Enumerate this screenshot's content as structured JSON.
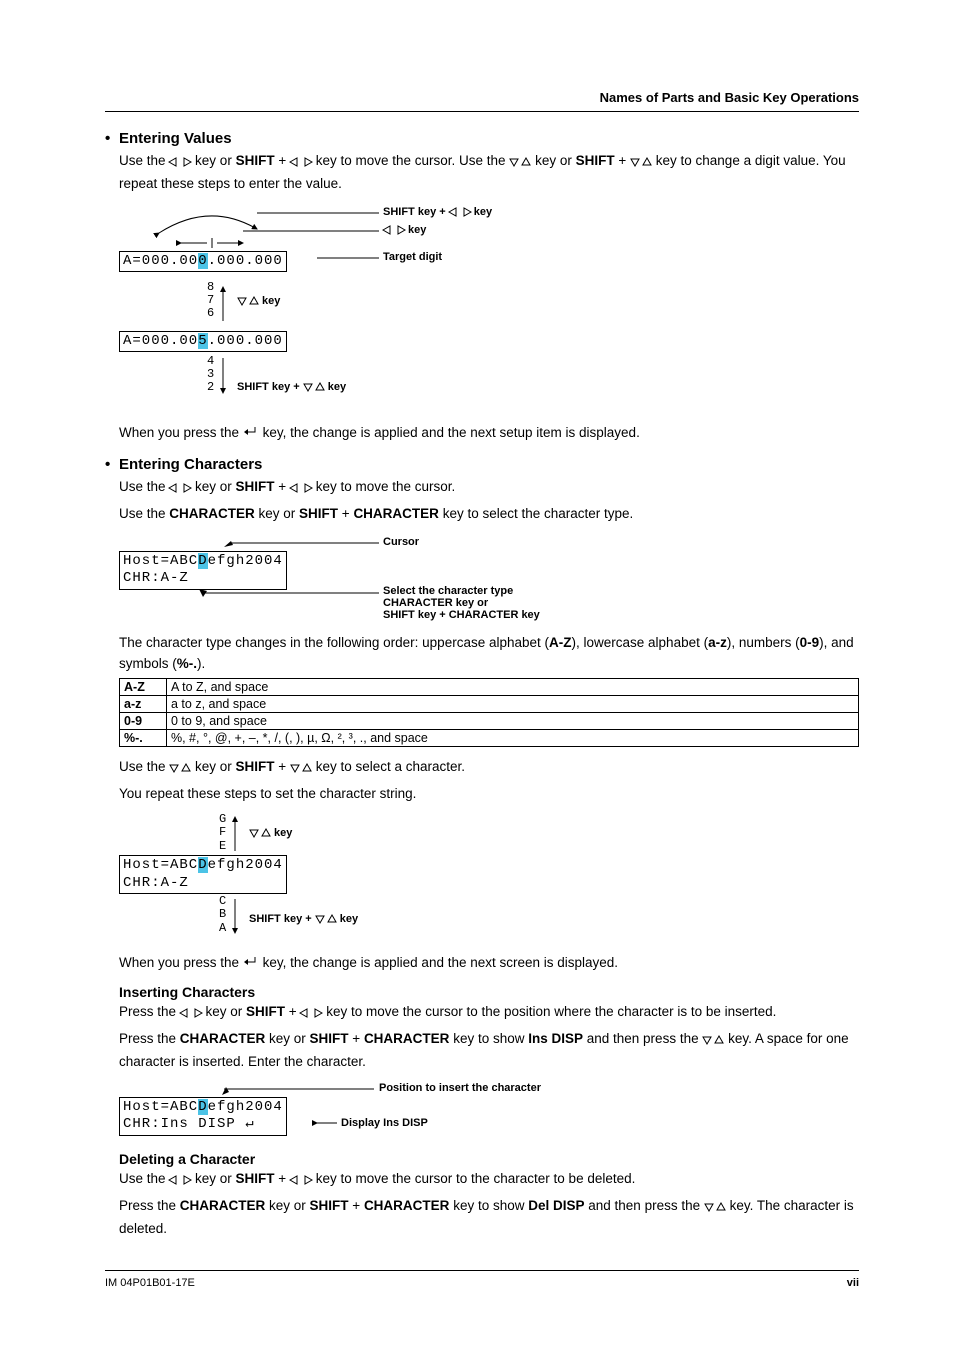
{
  "header": {
    "title": "Names of Parts and Basic Key Operations"
  },
  "sec_values": {
    "heading": "Entering Values",
    "intro_a": "Use the ",
    "intro_b": " key or ",
    "intro_c": " + ",
    "intro_d": " key to move the cursor. Use the ",
    "intro_e": " key or ",
    "intro_f": " + ",
    "intro_g": " key to change a digit value. You repeat these steps to enter the value.",
    "shift": "SHIFT",
    "lbl_shift_lr": "SHIFT key + ",
    "lbl_lr": " key",
    "lbl_key": " key",
    "lbl_target": "Target digit",
    "lbl_ud": " key",
    "lbl_shift_ud": "SHIFT key + ",
    "lcd1_pre": "A=000.00",
    "lcd1_hl": "0",
    "lcd1_post": ".000.000",
    "lcd2_pre": "A=000.00",
    "lcd2_hl": "5",
    "lcd2_post": ".000.000",
    "stack_up": [
      "8",
      "7",
      "6"
    ],
    "stack_dn": [
      "4",
      "3",
      "2"
    ],
    "post_a": "When you press the ",
    "post_b": " key, the change is applied and the next setup item is displayed."
  },
  "sec_chars": {
    "heading": "Entering Characters",
    "l1a": "Use the ",
    "l1b": " key or ",
    "l1c": " + ",
    "l1d": " key to move the cursor.",
    "l2a": "Use the ",
    "l2b": " key or ",
    "l2c": " + ",
    "l2d": " key to select the character type.",
    "char_key": "CHARACTER",
    "shift": "SHIFT",
    "lbl_cursor": "Cursor",
    "lbl_select": "Select the character type",
    "lbl_char_key": "CHARACTER key or",
    "lbl_shift_char": "SHIFT key + CHARACTER key",
    "lcd1a_pre": "Host=ABC",
    "lcd1a_hl": "D",
    "lcd1a_post": "efgh2004",
    "lcd1b": "CHR:A-Z",
    "order_a": "The character type changes in the following order: uppercase alphabet (",
    "order_b": "), lowercase alphabet (",
    "order_c": "), numbers (",
    "order_d": "), and symbols (",
    "order_e": ").",
    "AZ": "A-Z",
    "az": "a-z",
    "n09": "0-9",
    "sym": "%-.",
    "table": [
      {
        "k": "A-Z",
        "v": "A to Z, and space"
      },
      {
        "k": "a-z",
        "v": "a to z, and space"
      },
      {
        "k": "0-9",
        "v": "0 to 9, and space"
      },
      {
        "k": "%-.",
        "v": "%, #, °, @, +, –, *, /, (, ), µ, Ω, ², ³, ., and space"
      }
    ],
    "sel_a": "Use the ",
    "sel_b": " key or ",
    "sel_c": " + ",
    "sel_d": " key to select a character.",
    "repeat": "You repeat these steps to set the character string.",
    "stack_up": [
      "G",
      "F",
      "E"
    ],
    "stack_dn": [
      "C",
      "B",
      "A"
    ],
    "lbl_ud": " key",
    "lbl_shift_ud": "SHIFT key + ",
    "post_a": "When you press the ",
    "post_b": " key, the change is applied and the next screen is displayed."
  },
  "sec_insert": {
    "heading": "Inserting Characters",
    "l1a": "Press the ",
    "l1b": " key or ",
    "l1c": " + ",
    "l1d": " key to move the cursor to the position where the character is to be inserted.",
    "l2a": "Press the ",
    "l2b": " key or ",
    "l2c": " + ",
    "l2d": " key to show ",
    "l2e": " and then press the ",
    "l2f": " key. A space for one character is inserted. Enter the character.",
    "ins_disp": "Ins DISP",
    "char_key": "CHARACTER",
    "shift": "SHIFT",
    "lbl_pos": "Position to insert the character",
    "lbl_disp": "Display Ins DISP",
    "lcd_a_pre": "Host=ABC",
    "lcd_a_hl": "D",
    "lcd_a_post": "efgh2004",
    "lcd_b": "CHR:Ins   DISP ",
    "enter_glyph": "↵"
  },
  "sec_delete": {
    "heading": "Deleting a Character",
    "l1a": "Use the ",
    "l1b": " key or ",
    "l1c": " + ",
    "l1d": " key to move the cursor to the character to be deleted.",
    "l2a": "Press the ",
    "l2b": " key or ",
    "l2c": " + ",
    "l2d": " key to show ",
    "l2e": " and then press the ",
    "l2f": " key. The character is deleted.",
    "del_disp": "Del DISP",
    "char_key": "CHARACTER",
    "shift": "SHIFT"
  },
  "footer": {
    "left": "IM 04P01B01-17E",
    "right": "vii"
  },
  "glyphs": {
    "enter": "↵"
  }
}
